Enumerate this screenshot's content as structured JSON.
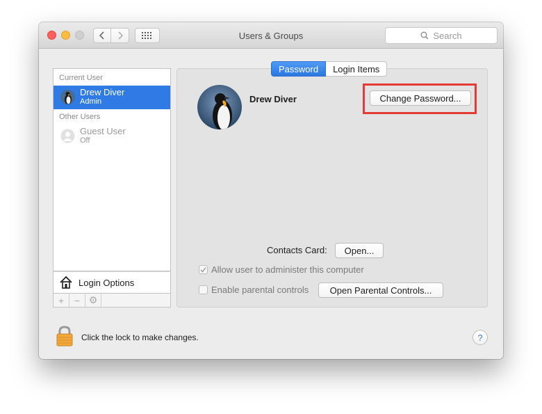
{
  "window": {
    "title": "Users & Groups"
  },
  "toolbar": {
    "back_icon": "chevron-left-icon",
    "forward_icon": "chevron-right-icon",
    "grid_icon": "grid-icon"
  },
  "search": {
    "placeholder": "Search"
  },
  "sidebar": {
    "current_user_label": "Current User",
    "other_users_label": "Other Users",
    "users": [
      {
        "name": "Drew Diver",
        "role": "Admin",
        "selected": true
      },
      {
        "name": "Guest User",
        "role": "Off",
        "selected": false
      }
    ],
    "login_options_label": "Login Options",
    "buttons": [
      "+",
      "−",
      "⚙"
    ]
  },
  "tabs": [
    {
      "label": "Password",
      "active": true
    },
    {
      "label": "Login Items",
      "active": false
    }
  ],
  "profile": {
    "name": "Drew Diver"
  },
  "buttons": {
    "change_password": "Change Password...",
    "open": "Open...",
    "open_parental": "Open Parental Controls..."
  },
  "contacts": {
    "label": "Contacts Card:"
  },
  "checkboxes": {
    "admin": {
      "label": "Allow user to administer this computer",
      "checked": true
    },
    "parental": {
      "label": "Enable parental controls",
      "checked": false
    }
  },
  "lock": {
    "text": "Click the lock to make changes."
  },
  "help": {
    "label": "?"
  },
  "colors": {
    "accent": "#2f7ae5",
    "highlight": "#e53a35"
  }
}
